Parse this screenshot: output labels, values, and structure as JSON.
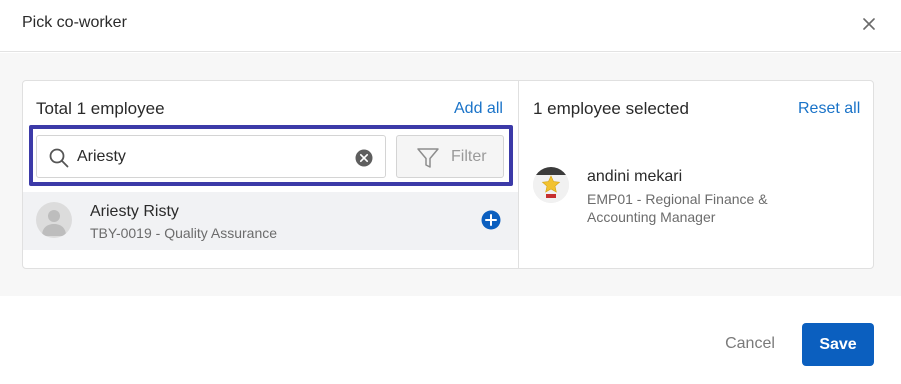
{
  "dialog": {
    "title": "Pick co-worker",
    "close_icon": "close-icon"
  },
  "left_panel": {
    "title": "Total 1 employee",
    "add_all_label": "Add all",
    "search": {
      "value": "Ariesty",
      "placeholder": ""
    },
    "filter_label": "Filter",
    "results": [
      {
        "name": "Ariesty Risty",
        "detail": "TBY-0019 - Quality Assurance"
      }
    ]
  },
  "right_panel": {
    "title": "1 employee selected",
    "reset_all_label": "Reset all",
    "selected": [
      {
        "name": "andini mekari",
        "detail": "EMP01 - Regional Finance & Accounting Manager"
      }
    ]
  },
  "footer": {
    "cancel_label": "Cancel",
    "save_label": "Save"
  },
  "colors": {
    "accent": "#1a73c8",
    "primary_button": "#0b5fbf",
    "highlight_border": "#3c3aa8"
  }
}
